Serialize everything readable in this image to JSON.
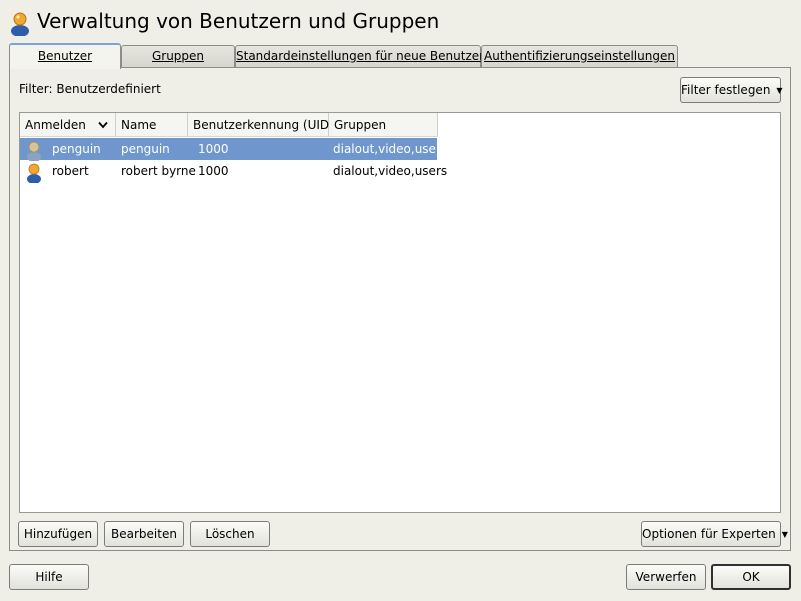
{
  "window": {
    "title": "Verwaltung von Benutzern und Gruppen"
  },
  "tabs": [
    {
      "label": "Benutzer",
      "mnemonic": "B",
      "active": true
    },
    {
      "label": "Gruppen",
      "mnemonic": "G",
      "active": false
    },
    {
      "label": "Standardeinstellungen für neue Benutzer",
      "mnemonic": "S",
      "active": false
    },
    {
      "label": "Authentifizierungseinstellungen",
      "mnemonic": "A",
      "active": false
    }
  ],
  "filter": {
    "label": "Filter: Benutzerdefiniert",
    "button_label": "Filter festlegen"
  },
  "table": {
    "columns": [
      "Anmelden",
      "Name",
      "Benutzerkennung (UID)",
      "Gruppen"
    ],
    "rows": [
      {
        "login": "penguin",
        "name": "penguin",
        "uid": "1000",
        "groups": "dialout,video,users",
        "selected": true,
        "icon": "user-icon"
      },
      {
        "login": "robert",
        "name": "robert byrne",
        "uid": "1000",
        "groups": "dialout,video,users",
        "selected": false,
        "icon": "user-icon"
      }
    ]
  },
  "actions": {
    "add": "Hinzufügen",
    "edit": "Bearbeiten",
    "delete": "Löschen",
    "expert": "Optionen für Experten"
  },
  "footer": {
    "help": "Hilfe",
    "discard": "Verwerfen",
    "ok": "OK"
  },
  "colors": {
    "selection": "#6f97cd",
    "background": "#efefe7",
    "tab_highlight": "#7ea2d6"
  }
}
